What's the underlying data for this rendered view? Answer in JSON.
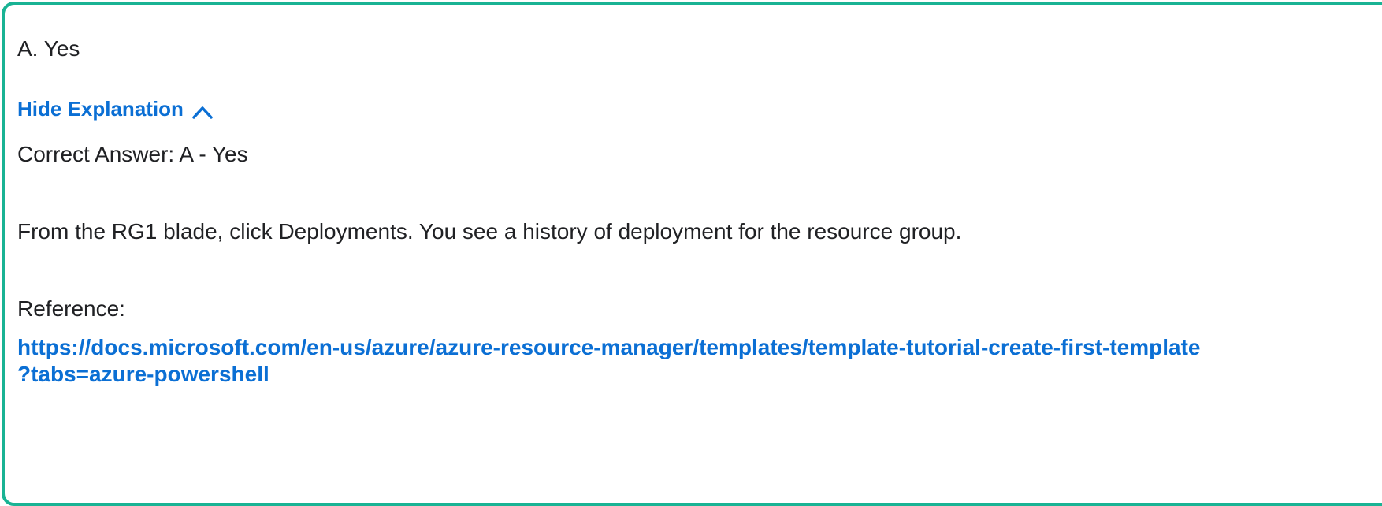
{
  "question": {
    "selected_option": "A. Yes",
    "toggle_label": "Hide Explanation",
    "toggle_icon": "chevron-up-icon",
    "accent_color": "#0b6fd4",
    "border_color": "#19b394"
  },
  "explanation": {
    "correct_answer": "Correct Answer: A - Yes",
    "body": "From the RG1 blade, click Deployments. You see a history of deployment for the resource group.",
    "reference_label": "Reference:",
    "reference_link_line1": "https://docs.microsoft.com/en-us/azure/azure-resource-manager/templates/template-tutorial-create-first-template",
    "reference_link_line2": "?tabs=azure-powershell"
  }
}
